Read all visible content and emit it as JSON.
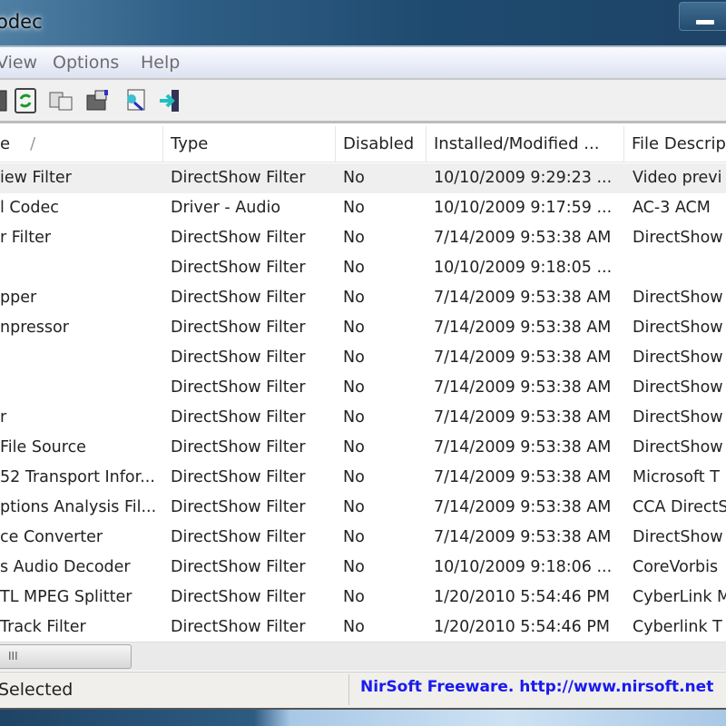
{
  "window": {
    "title": "odec"
  },
  "menu": [
    "View",
    "Options",
    "Help"
  ],
  "toolbar": [
    {
      "icon": "save-icon"
    },
    {
      "icon": "refresh-icon"
    },
    {
      "icon": "copy-icon"
    },
    {
      "icon": "properties-icon"
    },
    {
      "icon": "find-icon"
    },
    {
      "icon": "exit-icon"
    }
  ],
  "columns": [
    "e",
    "Type",
    "Disabled",
    "Installed/Modified ...",
    "File Descrip"
  ],
  "sort_indicator": "/",
  "rows": [
    [
      "iew Filter",
      "DirectShow Filter",
      "No",
      "10/10/2009 9:29:23 ...",
      "Video previ"
    ],
    [
      "l Codec",
      "Driver - Audio",
      "No",
      "10/10/2009 9:17:59 ...",
      "AC-3 ACM"
    ],
    [
      "r Filter",
      "DirectShow Filter",
      "No",
      "7/14/2009 9:53:38 AM",
      "DirectShow"
    ],
    [
      "",
      "DirectShow Filter",
      "No",
      "10/10/2009 9:18:05 ...",
      ""
    ],
    [
      "pper",
      "DirectShow Filter",
      "No",
      "7/14/2009 9:53:38 AM",
      "DirectShow"
    ],
    [
      "npressor",
      "DirectShow Filter",
      "No",
      "7/14/2009 9:53:38 AM",
      "DirectShow"
    ],
    [
      "",
      "DirectShow Filter",
      "No",
      "7/14/2009 9:53:38 AM",
      "DirectShow"
    ],
    [
      "",
      "DirectShow Filter",
      "No",
      "7/14/2009 9:53:38 AM",
      "DirectShow"
    ],
    [
      "r",
      "DirectShow Filter",
      "No",
      "7/14/2009 9:53:38 AM",
      "DirectShow"
    ],
    [
      "File Source",
      "DirectShow Filter",
      "No",
      "7/14/2009 9:53:38 AM",
      "DirectShow"
    ],
    [
      "52 Transport Infor...",
      "DirectShow Filter",
      "No",
      "7/14/2009 9:53:38 AM",
      "Microsoft T"
    ],
    [
      "ptions Analysis Fil...",
      "DirectShow Filter",
      "No",
      "7/14/2009 9:53:38 AM",
      "CCA DirectS"
    ],
    [
      "ce Converter",
      "DirectShow Filter",
      "No",
      "7/14/2009 9:53:38 AM",
      "DirectShow"
    ],
    [
      "s Audio Decoder",
      "DirectShow Filter",
      "No",
      "10/10/2009 9:18:06 ...",
      "CoreVorbis"
    ],
    [
      "TL MPEG Splitter",
      "DirectShow Filter",
      "No",
      "1/20/2010 5:54:46 PM",
      "CyberLink M"
    ],
    [
      "Track Filter",
      "DirectShow Filter",
      "No",
      "1/20/2010 5:54:46 PM",
      "Cyberlink T"
    ]
  ],
  "scrollbar": {
    "grip": "III"
  },
  "status": {
    "left": "Selected",
    "right": "NirSoft Freeware.  http://www.nirsoft.net"
  }
}
